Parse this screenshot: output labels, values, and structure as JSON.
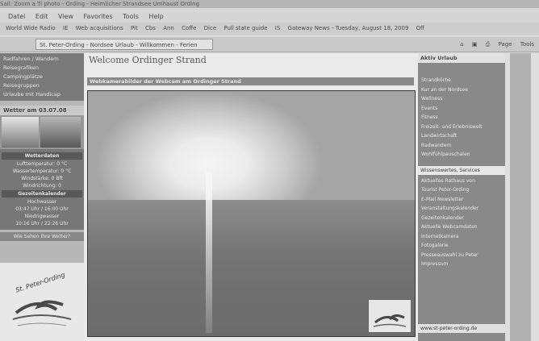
{
  "window": {
    "title": "Sail: Zoom a Ti photo - Ording - Heimlicher Strandsee Umhaust Ording"
  },
  "menu": [
    "Datei",
    "Edit",
    "View",
    "Favorites",
    "Tools",
    "Help"
  ],
  "bookmarks": [
    "World Wide Radio",
    "IE",
    "Web acquisitions",
    "Pit",
    "Cbs",
    "Ann",
    "Coffe",
    "Dice",
    "Pull state guide",
    "IS",
    "Gateway News - Tuesday, August 18, 2009",
    "Off"
  ],
  "tab": {
    "label": "St. Peter-Ording - Nordsee Urlaub - Willkommen - Ferien"
  },
  "toolbar": [
    "Page",
    "Tools"
  ],
  "left_menu": [
    "Radfahren / Wandern",
    "Reisegrafiken",
    "Campingplätze",
    "Reisegruppen",
    "Urlaube mit Handicap"
  ],
  "weather": {
    "heading": "Wetter am 03.07.08",
    "subheading": "Wetterdaten",
    "lines": [
      "Lufttemperatur: 0 °C",
      "Wassertemperatur: 0 °C",
      "Windstärke: 0 Bft",
      "Windrichtung: 0"
    ],
    "tides_heading": "Gezeitenkalender",
    "tides": [
      "Hochwasser",
      "03:47 Uhr / 16:00 Uhr",
      "Niedrigwasser",
      "10:16 Uhr / 22:26 Uhr"
    ],
    "link": "Wie Sehen Ihre Wetter?"
  },
  "logo": {
    "text": "St. Peter-Ording"
  },
  "main": {
    "welcome": "Welcome Ordinger Strand",
    "cam_heading": "Webkamerabilder der Webcam am Ordinger Strand"
  },
  "right_nav": {
    "heading": "Aktiv Urlaub",
    "items": [
      "Strandkörbe",
      "Kur an der Nordsee",
      "Wellness",
      "Events",
      "Fitness",
      "Freizeit- und Erlebniswelt",
      "Landwirtschaft",
      "Radwandern",
      "Wohlfühlpauschalen"
    ],
    "section": "Wissenswertes, Services",
    "items2": [
      "Aktuelles Rathaus von",
      "Tourist Peter-Ording",
      "E-Mail Newsletter",
      "Veranstaltungskalender",
      "Gezeitenkalender",
      "Aktuelle Webcamdaten",
      "Internetkamera",
      "Fotogalerie",
      "Presseauswahl zu Peter",
      "Impressum"
    ],
    "footer": "www.st-peter-ording.de"
  }
}
